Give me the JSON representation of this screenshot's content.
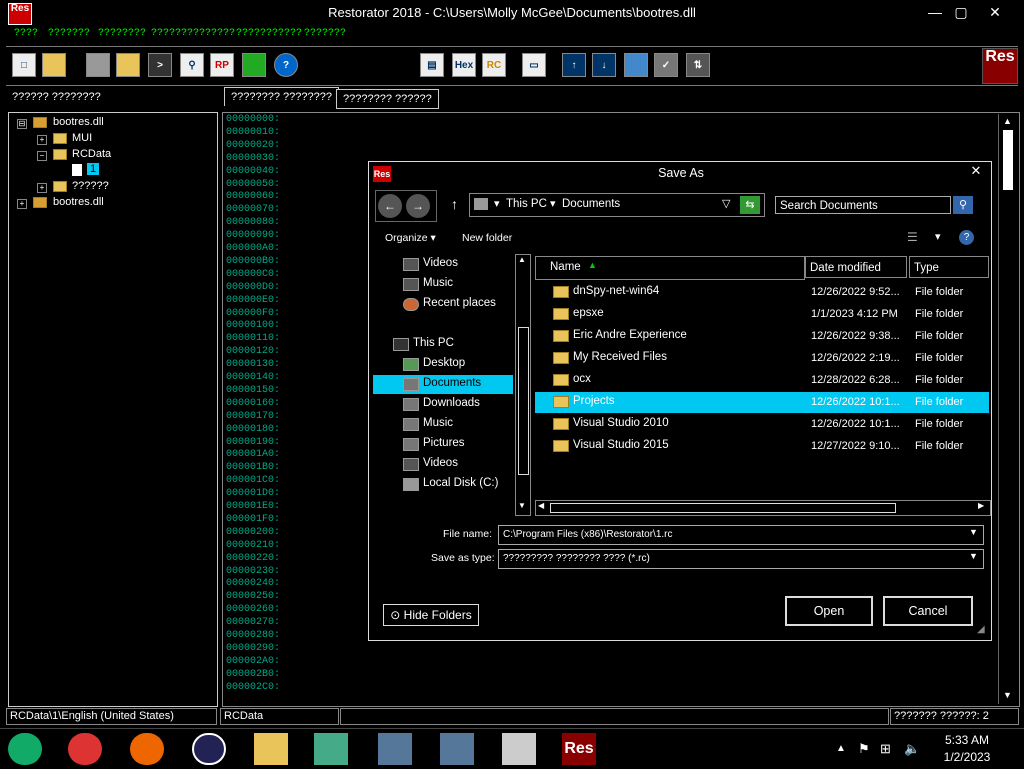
{
  "window": {
    "title": "Restorator 2018 - C:\\Users\\Molly McGee\\Documents\\bootres.dll",
    "logo_text": "Res",
    "minimize": "—",
    "maximize": "▢",
    "close": "✕"
  },
  "menu": [
    "????",
    "???????",
    "????????",
    "??????????????",
    "???????????",
    "???????"
  ],
  "toolbar": {
    "hex_label": "Hex",
    "rc_label": "RC",
    "rp_label": "RP",
    "help_label": "?",
    "res_logo": "Res"
  },
  "left_panel": {
    "header": "?????? ????????",
    "tree": [
      {
        "label": "bootres.dll",
        "expander": "⊟"
      },
      {
        "label": "MUI",
        "expander": "+"
      },
      {
        "label": "RCData",
        "expander": "−"
      },
      {
        "label": "1"
      },
      {
        "label": "??????",
        "expander": "+"
      },
      {
        "label": "bootres.dll",
        "expander": "+"
      }
    ]
  },
  "tabs": [
    "???????? ????????",
    "???????? ??????"
  ],
  "hex_offsets": [
    "00000000:",
    "00000010:",
    "00000020:",
    "00000030:",
    "00000040:",
    "00000050:",
    "00000060:",
    "00000070:",
    "00000080:",
    "00000090:",
    "000000A0:",
    "000000B0:",
    "000000C0:",
    "000000D0:",
    "000000E0:",
    "000000F0:",
    "00000100:",
    "00000110:",
    "00000120:",
    "00000130:",
    "00000140:",
    "00000150:",
    "00000160:",
    "00000170:",
    "00000180:",
    "00000190:",
    "000001A0:",
    "000001B0:",
    "000001C0:",
    "000001D0:",
    "000001E0:",
    "000001F0:",
    "00000200:",
    "00000210:",
    "00000220:",
    "00000230:",
    "00000240:",
    "00000250:",
    "00000260:",
    "00000270:",
    "00000280:",
    "00000290:",
    "000002A0:",
    "000002B0:",
    "000002C0:"
  ],
  "status": {
    "path": "RCData\\1\\English (United States)",
    "type": "RCData",
    "middle": "",
    "count": "??????? ??????: 2"
  },
  "dialog": {
    "title": "Save As",
    "logo_text": "Res",
    "close": "✕",
    "breadcrumb": [
      "This PC",
      "Documents"
    ],
    "search_placeholder": "Search Documents",
    "organize": "Organize",
    "new_folder": "New folder",
    "help": "?",
    "nav": {
      "favorites": [
        "Videos",
        "Music",
        "Recent places"
      ],
      "this_pc": "This PC",
      "pc_items": [
        "Desktop",
        "Documents",
        "Downloads",
        "Music",
        "Pictures",
        "Videos",
        "Local Disk (C:)"
      ],
      "selected": "Documents"
    },
    "columns": {
      "name": "Name",
      "date": "Date modified",
      "type": "Type"
    },
    "files": [
      {
        "name": "dnSpy-net-win64",
        "date": "12/26/2022 9:52...",
        "type": "File folder"
      },
      {
        "name": "epsxe",
        "date": "1/1/2023 4:12 PM",
        "type": "File folder"
      },
      {
        "name": "Eric Andre Experience",
        "date": "12/26/2022 9:38...",
        "type": "File folder"
      },
      {
        "name": "My Received Files",
        "date": "12/26/2022 2:19...",
        "type": "File folder"
      },
      {
        "name": "ocx",
        "date": "12/28/2022 6:28...",
        "type": "File folder"
      },
      {
        "name": "Projects",
        "date": "12/26/2022 10:1...",
        "type": "File folder",
        "selected": true
      },
      {
        "name": "Visual Studio 2010",
        "date": "12/26/2022 10:1...",
        "type": "File folder"
      },
      {
        "name": "Visual Studio 2015",
        "date": "12/27/2022 9:10...",
        "type": "File folder"
      }
    ],
    "file_name_label": "File name:",
    "file_name_value": "C:\\Program Files (x86)\\Restorator\\1.rc",
    "save_type_label": "Save as type:",
    "save_type_value": "????????? ???????? ???? (*.rc)",
    "hide_folders": "Hide Folders",
    "open": "Open",
    "cancel": "Cancel"
  },
  "taskbar": {
    "time": "5:33 AM",
    "date": "1/2/2023",
    "res_text": "Res"
  },
  "colors": {
    "selection": "#00c8f0",
    "hex_offset": "#00aa88",
    "menu": "#00ff00"
  }
}
